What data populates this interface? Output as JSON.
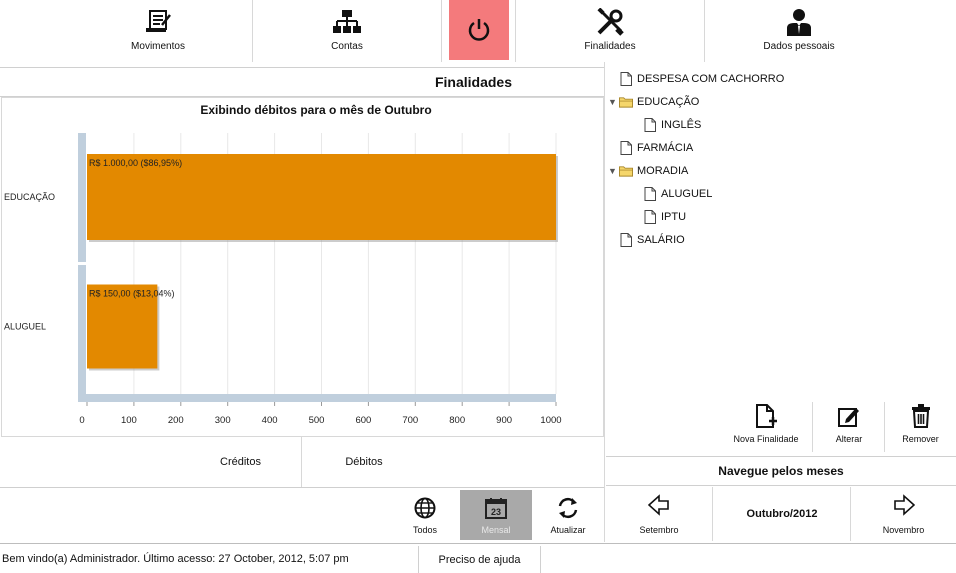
{
  "toolbar": {
    "items": [
      {
        "label": "Movimentos",
        "icon": "movements-icon"
      },
      {
        "label": "Contas",
        "icon": "accounts-hierarchy-icon"
      },
      {
        "label": "",
        "icon": "power-icon"
      },
      {
        "label": "Finalidades",
        "icon": "tools-icon"
      },
      {
        "label": "Dados pessoais",
        "icon": "user-tie-icon"
      }
    ],
    "power_color": "#f47a7c"
  },
  "page_title": "Finalidades",
  "chart_data": {
    "type": "bar",
    "orientation": "horizontal",
    "title": "Exibindo débitos para o mês de Outubro",
    "categories": [
      "EDUCAÇÃO",
      "ALUGUEL"
    ],
    "values": [
      1000,
      150
    ],
    "data_labels": [
      "R$ 1.000,00 ($86,95%)",
      "R$ 150,00 ($13,04%)"
    ],
    "xlim": [
      0,
      1000
    ],
    "x_ticks": [
      "0",
      "100",
      "200",
      "300",
      "400",
      "500",
      "600",
      "700",
      "800",
      "900",
      "1000"
    ],
    "grid": true,
    "bar_color": "#e38900"
  },
  "filter_tabs": [
    "Créditos",
    "Débitos"
  ],
  "view_buttons": [
    {
      "label": "Todos",
      "icon": "globe-icon"
    },
    {
      "label": "Mensal",
      "icon": "calendar-icon",
      "calendar_day": "23"
    },
    {
      "label": "Atualizar",
      "icon": "refresh-icon"
    }
  ],
  "tree": [
    {
      "label": "DESPESA COM CACHORRO",
      "type": "file",
      "level": 0
    },
    {
      "label": "EDUCAÇÃO",
      "type": "folder",
      "level": 0,
      "expanded": true
    },
    {
      "label": "INGLÊS",
      "type": "file",
      "level": 1
    },
    {
      "label": "FARMÁCIA",
      "type": "file",
      "level": 0
    },
    {
      "label": "MORADIA",
      "type": "folder",
      "level": 0,
      "expanded": true
    },
    {
      "label": "ALUGUEL",
      "type": "file",
      "level": 1
    },
    {
      "label": "IPTU",
      "type": "file",
      "level": 1
    },
    {
      "label": "SALÁRIO",
      "type": "file",
      "level": 0
    }
  ],
  "actions": [
    {
      "label": "Nova Finalidade",
      "icon": "new-file-icon"
    },
    {
      "label": "Alterar",
      "icon": "edit-icon"
    },
    {
      "label": "Remover",
      "icon": "trash-icon"
    }
  ],
  "month_nav": {
    "title": "Navegue pelos meses",
    "prev": "Setembro",
    "current": "Outubro/2012",
    "next": "Novembro"
  },
  "status": {
    "text": "Bem vindo(a) Administrador. Último acesso: 27 October, 2012, 5:07 pm",
    "help": "Preciso de ajuda"
  }
}
